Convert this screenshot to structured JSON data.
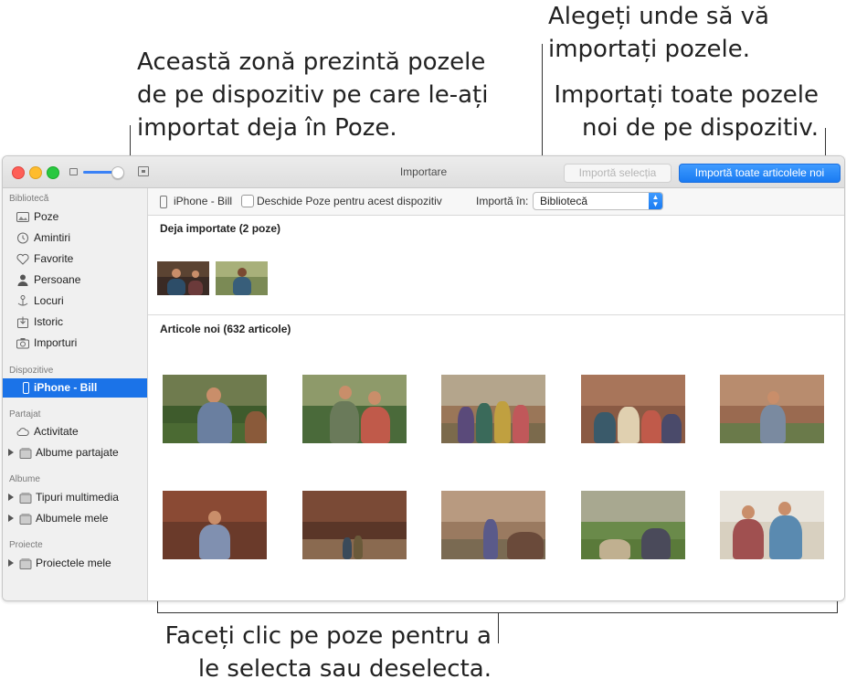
{
  "callouts": {
    "left": [
      "Această zonă prezintă pozele",
      "de pe dispozitiv pe care le-ați",
      "importat deja în Poze."
    ],
    "top": [
      "Alegeți unde să vă",
      "importați pozele."
    ],
    "right": [
      "Importați toate pozele",
      "noi de pe dispozitiv."
    ],
    "bottom": [
      "Faceți clic pe poze pentru a",
      "le selecta sau deselecta."
    ]
  },
  "window": {
    "title": "Importare",
    "import_selection_label": "Importă selecția",
    "import_all_label": "Importă toate articolele noi"
  },
  "sidebar": {
    "sections": {
      "library": "Bibliotecă",
      "devices": "Dispozitive",
      "shared": "Partajat",
      "albums": "Albume",
      "projects": "Proiecte"
    },
    "items": [
      {
        "label": "Poze",
        "icon": "photos-icon"
      },
      {
        "label": "Amintiri",
        "icon": "memories-icon"
      },
      {
        "label": "Favorite",
        "icon": "heart-icon"
      },
      {
        "label": "Persoane",
        "icon": "person-icon"
      },
      {
        "label": "Locuri",
        "icon": "pin-icon"
      },
      {
        "label": "Istoric",
        "icon": "history-icon"
      },
      {
        "label": "Importuri",
        "icon": "camera-icon"
      },
      {
        "label": "iPhone - Bill",
        "icon": "iphone-icon"
      },
      {
        "label": "Activitate",
        "icon": "cloud-icon"
      },
      {
        "label": "Albume partajate",
        "icon": "shared-albums-icon"
      },
      {
        "label": "Tipuri multimedia",
        "icon": "folder-icon"
      },
      {
        "label": "Albumele mele",
        "icon": "folder-icon"
      },
      {
        "label": "Proiectele mele",
        "icon": "folder-icon"
      }
    ]
  },
  "toolbar": {
    "device_label": "iPhone - Bill",
    "open_photos_label": "Deschide Poze pentru acest dispozitiv",
    "import_in_label": "Importă în:",
    "destination": "Bibliotecă"
  },
  "content": {
    "already_imported_title": "Deja importate (2 poze)",
    "new_items_title": "Articole noi (632 articole)"
  },
  "colors": {
    "accent": "#1b73e8",
    "sidebar_bg": "#f0f0f0"
  }
}
